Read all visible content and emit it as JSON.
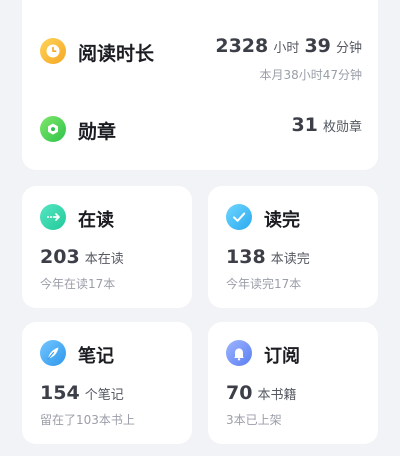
{
  "reading_time": {
    "label": "阅读时长",
    "hours": "2328",
    "hours_unit": "小时",
    "minutes": "39",
    "minutes_unit": "分钟",
    "month_text": "本月38小时47分钟",
    "icon": "clock-icon",
    "icon_color": "#f7b52c"
  },
  "medals": {
    "label": "勋章",
    "count": "31",
    "unit": "枚勋章",
    "icon": "medal-icon",
    "icon_color": "#3fd04f"
  },
  "cards": {
    "reading": {
      "title": "在读",
      "count": "203",
      "unit": "本在读",
      "sub": "今年在读17本",
      "icon": "arrow-right-icon",
      "icon_color": "#2fd6a8"
    },
    "finished": {
      "title": "读完",
      "count": "138",
      "unit": "本读完",
      "sub": "今年读完17本",
      "icon": "check-icon",
      "icon_color": "#37b8f5"
    },
    "notes": {
      "title": "笔记",
      "count": "154",
      "unit": "个笔记",
      "sub": "留在了103本书上",
      "icon": "feather-icon",
      "icon_color": "#3da6f2"
    },
    "subscriptions": {
      "title": "订阅",
      "count": "70",
      "unit": "本书籍",
      "sub": "3本已上架",
      "icon": "bell-icon",
      "icon_color": "#6f8ff7"
    }
  }
}
